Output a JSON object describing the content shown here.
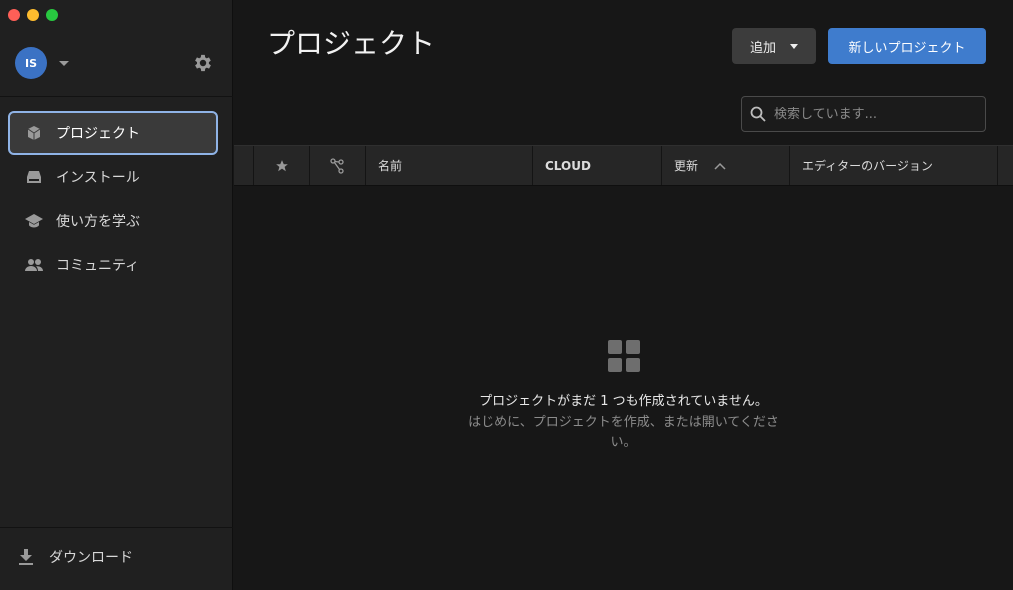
{
  "sidebar": {
    "avatar_initials": "IS",
    "nav": [
      {
        "label": "プロジェクト",
        "icon": "cube-icon",
        "active": true
      },
      {
        "label": "インストール",
        "icon": "drive-icon",
        "active": false
      },
      {
        "label": "使い方を学ぶ",
        "icon": "graduation-cap-icon",
        "active": false
      },
      {
        "label": "コミュニティ",
        "icon": "people-icon",
        "active": false
      }
    ],
    "download_label": "ダウンロード"
  },
  "main": {
    "title": "プロジェクト",
    "add_button": "追加",
    "new_project_button": "新しいプロジェクト",
    "search_placeholder": "検索しています...",
    "table": {
      "columns": [
        "名前",
        "CLOUD",
        "更新",
        "エディターのバージョン"
      ]
    },
    "empty_state": {
      "title": "プロジェクトがまだ 1 つも作成されていません。",
      "subtitle": "はじめに、プロジェクトを作成、または開いてください。"
    }
  },
  "colors": {
    "accent": "#3f7ccd",
    "active_border": "#8fb3e6",
    "sidebar_bg": "#202020",
    "main_bg": "#171717"
  }
}
